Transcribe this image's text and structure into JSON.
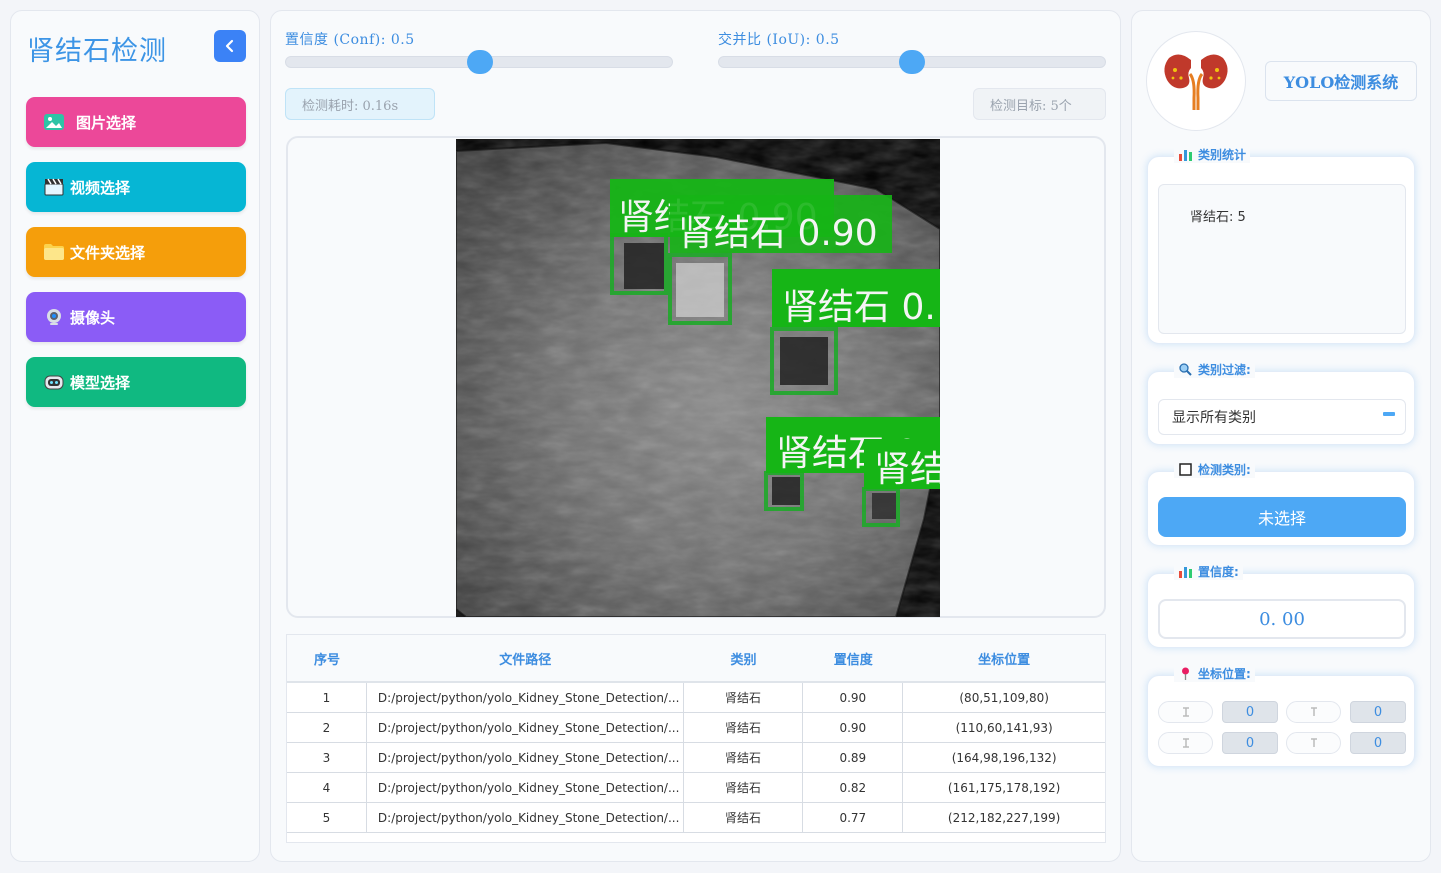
{
  "sidebar": {
    "title": "肾结石检测",
    "buttons": [
      {
        "label": "图片选择",
        "icon": "image-icon",
        "color": "#ec4899"
      },
      {
        "label": "视频选择",
        "icon": "clapper-icon",
        "color": "#06b6d4"
      },
      {
        "label": "文件夹选择",
        "icon": "folder-icon",
        "color": "#f59e0b"
      },
      {
        "label": "摄像头",
        "icon": "webcam-icon",
        "color": "#8b5cf6"
      },
      {
        "label": "模型选择",
        "icon": "robot-icon",
        "color": "#10b981"
      }
    ]
  },
  "controls": {
    "conf_label": "置信度 (Conf): 0.5",
    "conf_value": 0.5,
    "iou_label": "交并比 (IoU): 0.5",
    "iou_value": 0.5,
    "time_text": "检测耗时: 0.16s",
    "target_text": "检测目标: 5个"
  },
  "detections": [
    {
      "label": "肾结石 0.90"
    },
    {
      "label": "肾结石 0.90"
    },
    {
      "label": "肾结石 0."
    },
    {
      "label": "肾结石 0."
    },
    {
      "label": "肾结"
    }
  ],
  "table": {
    "headers": [
      "序号",
      "文件路径",
      "类别",
      "置信度",
      "坐标位置"
    ],
    "rows": [
      [
        "1",
        "D:/project/python/yolo_Kidney_Stone_Detection/...",
        "肾结石",
        "0.90",
        "(80,51,109,80)"
      ],
      [
        "2",
        "D:/project/python/yolo_Kidney_Stone_Detection/...",
        "肾结石",
        "0.90",
        "(110,60,141,93)"
      ],
      [
        "3",
        "D:/project/python/yolo_Kidney_Stone_Detection/...",
        "肾结石",
        "0.89",
        "(164,98,196,132)"
      ],
      [
        "4",
        "D:/project/python/yolo_Kidney_Stone_Detection/...",
        "肾结石",
        "0.82",
        "(161,175,178,192)"
      ],
      [
        "5",
        "D:/project/python/yolo_Kidney_Stone_Detection/...",
        "肾结石",
        "0.77",
        "(212,182,227,199)"
      ]
    ]
  },
  "right": {
    "system_title": "YOLO检测系统",
    "stats_label": "类别统计",
    "stats_text": "肾结石: 5",
    "filter_label": "类别过滤:",
    "filter_value": "显示所有类别",
    "detect_label": "检测类别:",
    "detect_button": "未选择",
    "conf_label": "置信度:",
    "conf_value": "0. 00",
    "coord_label": "坐标位置:",
    "coords": {
      "xmin": "0",
      "ymin": "0",
      "xmax": "0",
      "ymax": "0"
    }
  },
  "colors": {
    "accent": "#3b82f6",
    "detect_green": "#1fa82a"
  }
}
